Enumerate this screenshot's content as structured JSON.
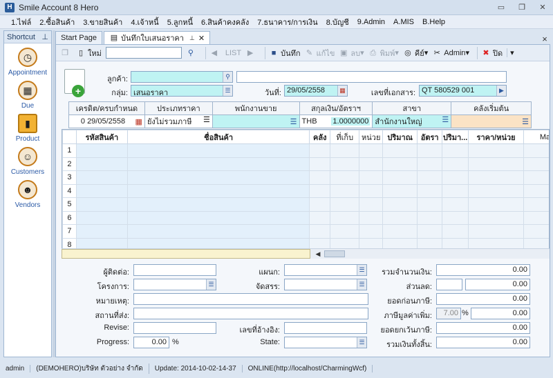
{
  "window": {
    "title": "Smile Account 8 Hero",
    "app_icon": "H"
  },
  "menu": [
    "1.ไฟล์",
    "2.ซื้อสินค้า",
    "3.ขายสินค้า",
    "4.เจ้าหนี้",
    "5.ลูกหนี้",
    "6.สินค้าคงคลัง",
    "7.ธนาคาร/การเงิน",
    "8.บัญชี",
    "9.Admin",
    "A.MIS",
    "B.Help"
  ],
  "shortcut": {
    "title": "Shortcut",
    "items": [
      {
        "label": "Appointment",
        "icon": "clock-icon"
      },
      {
        "label": "Due",
        "icon": "calendar-icon"
      },
      {
        "label": "Product",
        "icon": "box-icon"
      },
      {
        "label": "Customers",
        "icon": "people-icon"
      },
      {
        "label": "Vendors",
        "icon": "vendor-icon"
      }
    ]
  },
  "tabs": [
    {
      "label": "Start Page",
      "active": false
    },
    {
      "label": "บันทึกใบเสนอราคา",
      "active": true
    }
  ],
  "toolbar": {
    "new_label": "ใหม่",
    "list_label": "LIST",
    "save_label": "บันทึก",
    "edit_label": "แก้ไข",
    "delete_label": "ลบ",
    "print_label": "พิมพ์",
    "key_label": "คีย์",
    "admin_label": "Admin",
    "close_label": "ปิด"
  },
  "header": {
    "customer_label": "ลูกค้า:",
    "customer_code": "",
    "customer_name": "",
    "group_label": "กลุ่ม:",
    "group_value": "เสนอราคา",
    "date_label": "วันที่:",
    "date_value": "29/05/2558",
    "docno_label": "เลขที่เอกสาร:",
    "docno_value": "QT 580529 001"
  },
  "subheader": {
    "columns": [
      "เครดิต/ครบกำหนด",
      "ประเภทราคา",
      "พนักงานขาย",
      "สกุลเงิน/อัตราฯ",
      "สาขา",
      "คลังเริ่มต้น"
    ],
    "credit_days": "0",
    "due_date": "29/05/2558",
    "price_type": "ยังไม่รวมภาษี",
    "salesman": "",
    "currency": "THB",
    "rate": "1.0000000",
    "branch": "สำนักงานใหญ่",
    "warehouse": ""
  },
  "grid": {
    "columns": [
      "รหัสสินค้า",
      "ชื่อสินค้า",
      "คลัง",
      "ที่เก็บ",
      "หน่วย",
      "ปริมาณ",
      "อัตรา",
      "ปริมา...",
      "ราคา/หน่วย",
      "Ma"
    ],
    "rows": [
      "1",
      "2",
      "3",
      "4",
      "5",
      "6",
      "7",
      "8"
    ]
  },
  "footer": {
    "contact_label": "ผู้ติดต่อ:",
    "project_label": "โครงการ:",
    "note_label": "หมายเหตุ:",
    "ship_label": "สถานที่ส่ง:",
    "revise_label": "Revise:",
    "progress_label": "Progress:",
    "progress_value": "0.00",
    "progress_unit": "%",
    "dept_label": "แผนก:",
    "alloc_label": "จัดสรร:",
    "ref_label": "เลขที่อ้างอิง:",
    "state_label": "State:",
    "total_label": "รวมจำนวนเงิน:",
    "total_value": "0.00",
    "discount_label": "ส่วนลด:",
    "discount_value": "0.00",
    "before_vat_label": "ยอดก่อนภาษี:",
    "before_vat_value": "0.00",
    "vat_label": "ภาษีมูลค่าเพิ่ม:",
    "vat_rate": "7.00",
    "vat_unit": "%",
    "vat_value": "0.00",
    "exempt_label": "ยอดยกเว้นภาษี:",
    "exempt_value": "0.00",
    "grand_label": "รวมเงินทั้งสิ้น:",
    "grand_value": "0.00"
  },
  "status": {
    "user": "admin",
    "company": "(DEMOHERO)บริษัท ตัวอย่าง จำกัด",
    "update": "Update: 2014-10-02-14-37",
    "conn": "ONLINE(http://localhost/CharmingWcf)"
  }
}
